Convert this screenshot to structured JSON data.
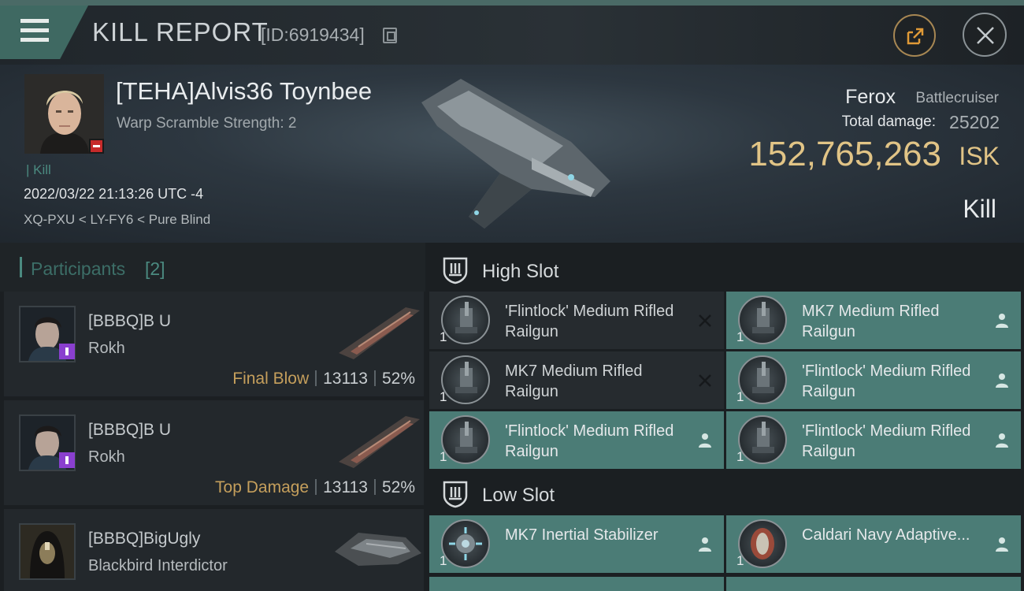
{
  "header": {
    "title": "KILL REPORT",
    "report_id": "[ID:6919434]"
  },
  "victim": {
    "name": "[TEHA]Alvis36 Toynbee",
    "warp_scramble": "Warp Scramble Strength: 2",
    "kill_tag": "| Kill",
    "timestamp": "2022/03/22 21:13:26 UTC -4",
    "location": "XQ-PXU < LY-FY6 < Pure Blind",
    "ship_name": "Ferox",
    "ship_class": "Battlecruiser",
    "total_damage_label": "Total damage:",
    "total_damage": "25202",
    "isk_value": "152,765,263",
    "isk_unit": "ISK",
    "result": "Kill"
  },
  "participants": {
    "title": "Participants",
    "count": "[2]",
    "items": [
      {
        "name": "[BBBQ]B U",
        "ship": "Rokh",
        "tag": "Final Blow",
        "damage": "13113",
        "percent": "52%"
      },
      {
        "name": "[BBBQ]B U",
        "ship": "Rokh",
        "tag": "Top Damage",
        "damage": "13113",
        "percent": "52%"
      },
      {
        "name": "[BBBQ]BigUgly",
        "ship": "Blackbird Interdictor"
      }
    ]
  },
  "fitting": {
    "high_slot_title": "High Slot",
    "low_slot_title": "Low Slot",
    "high_slot": [
      {
        "name": "'Flintlock' Medium Rifled Railgun",
        "qty": "1",
        "status": "destroyed"
      },
      {
        "name": "MK7 Medium Rifled Railgun",
        "qty": "1",
        "status": "dropped"
      },
      {
        "name": "MK7 Medium Rifled Railgun",
        "qty": "1",
        "status": "destroyed"
      },
      {
        "name": "'Flintlock' Medium Rifled Railgun",
        "qty": "1",
        "status": "dropped"
      },
      {
        "name": "'Flintlock' Medium Rifled Railgun",
        "qty": "1",
        "status": "dropped"
      },
      {
        "name": "'Flintlock' Medium Rifled Railgun",
        "qty": "1",
        "status": "dropped"
      }
    ],
    "low_slot": [
      {
        "name": "MK7 Inertial Stabilizer",
        "qty": "1",
        "status": "dropped"
      },
      {
        "name": "Caldari Navy Adaptive...",
        "qty": "1",
        "status": "dropped"
      }
    ]
  },
  "icons": {
    "menu": "hamburger-icon",
    "copy": "copy-icon",
    "share": "share-icon",
    "close": "close-icon",
    "destroyed": "x-icon",
    "dropped": "person-icon"
  },
  "colors": {
    "accent_teal": "#4b7c76",
    "isk_gold": "#e1c486",
    "tag_gold": "#c59f5c",
    "kill_red": "#c62a2a"
  }
}
